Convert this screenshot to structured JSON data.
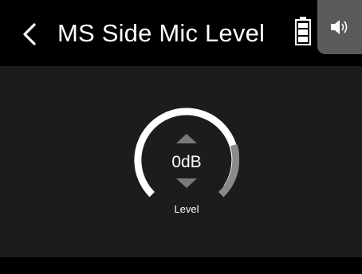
{
  "header": {
    "title": "MS Side Mic Level",
    "back_icon": "chevron-left-icon",
    "battery_icon": "battery-icon",
    "speaker_icon": "speaker-icon"
  },
  "level_control": {
    "value": "0dB",
    "label": "Level",
    "up_icon": "up-triangle-icon",
    "down_icon": "down-triangle-icon"
  },
  "colors": {
    "header_bg": "#000000",
    "main_bg": "#1c1c1c",
    "ring": "#ffffff",
    "ring_remaining": "#8a8a8a",
    "arrow": "#7a7a7a",
    "speaker_tab_bg": "#5a5a5a"
  }
}
